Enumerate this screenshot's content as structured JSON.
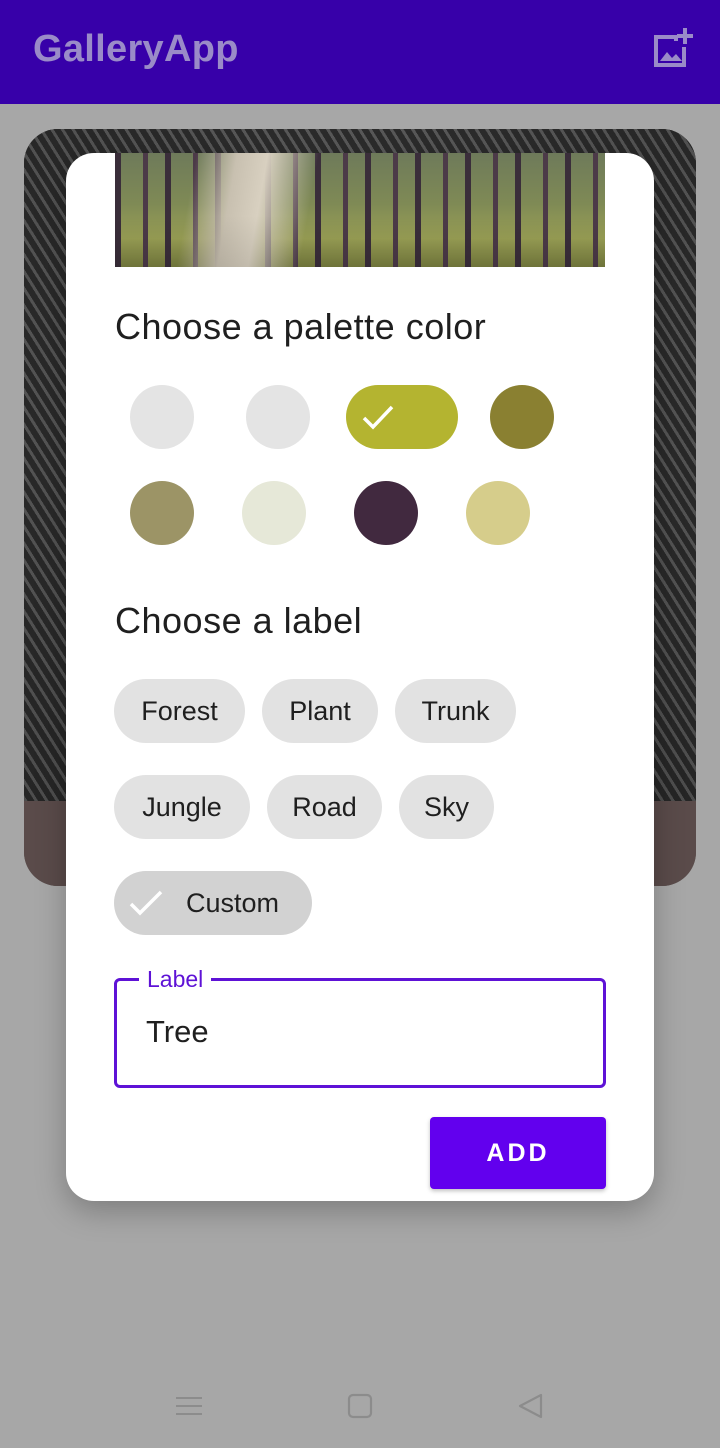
{
  "app_bar": {
    "title": "GalleryApp",
    "add_icon": "add-photo-icon"
  },
  "dialog": {
    "palette_title": "Choose a palette color",
    "palette_colors": [
      {
        "color": "#e4e4e4",
        "selected": false
      },
      {
        "color": "#e4e4e4",
        "selected": false
      },
      {
        "color": "#b4b430",
        "selected": true
      },
      {
        "color": "#8a8031",
        "selected": false
      },
      {
        "color": "#9c9466",
        "selected": false
      },
      {
        "color": "#e6e8d8",
        "selected": false
      },
      {
        "color": "#41293f",
        "selected": false
      },
      {
        "color": "#d6cd8b",
        "selected": false
      }
    ],
    "label_title": "Choose a label",
    "labels": [
      "Forest",
      "Plant",
      "Trunk",
      "Jungle",
      "Road",
      "Sky"
    ],
    "custom_label": "Custom",
    "custom_selected": true,
    "field_label": "Label",
    "field_value": "Tree",
    "add_button": "ADD"
  },
  "colors": {
    "app_bar": "#3700a9",
    "accent": "#6200ee",
    "field_outline": "#5e12d6"
  },
  "nav_bar": {
    "icons": [
      "menu-icon",
      "home-square-icon",
      "back-triangle-icon"
    ]
  }
}
